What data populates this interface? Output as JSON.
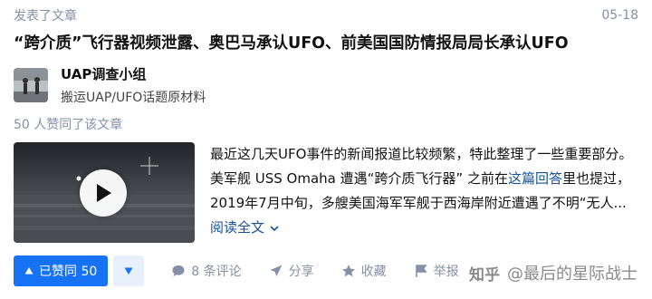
{
  "meta": {
    "status": "发表了文章",
    "date": "05-18"
  },
  "article": {
    "title": "“跨介质”飞行器视频泄露、奥巴马承认UFO、前美国国防情报局局长承认UFO",
    "excerpt": "最近这几天UFO事件的新闻报道比较频繁，特此整理了一些重要部分。 美军舰 USS Omaha 遭遇“跨介质飞行器” 之前在",
    "excerpt_link": "这篇回答",
    "excerpt_rest": "里也提过，2019年7月中旬，多艘美国海军军舰于西海岸附近遭遇了不明“无人...",
    "read_more": "阅读全文"
  },
  "author": {
    "name": "UAP调查小组",
    "bio": "搬运UAP/UFO话题原材料"
  },
  "likes_note": "50 人赞同了该文章",
  "actions": {
    "vote_up": "已赞同 50",
    "comments": "8 条评论",
    "share": "分享",
    "favorite": "收藏",
    "report": "举报"
  },
  "watermark": {
    "logo": "知乎",
    "text": "@最后的星际战士"
  },
  "colors": {
    "accent": "#1772f6",
    "muted": "#8590a6",
    "link": "#175199"
  },
  "icons": [
    "play-icon",
    "triangle-up-icon",
    "triangle-down-icon",
    "comment-icon",
    "share-icon",
    "star-icon",
    "flag-icon",
    "chevron-down-icon"
  ]
}
